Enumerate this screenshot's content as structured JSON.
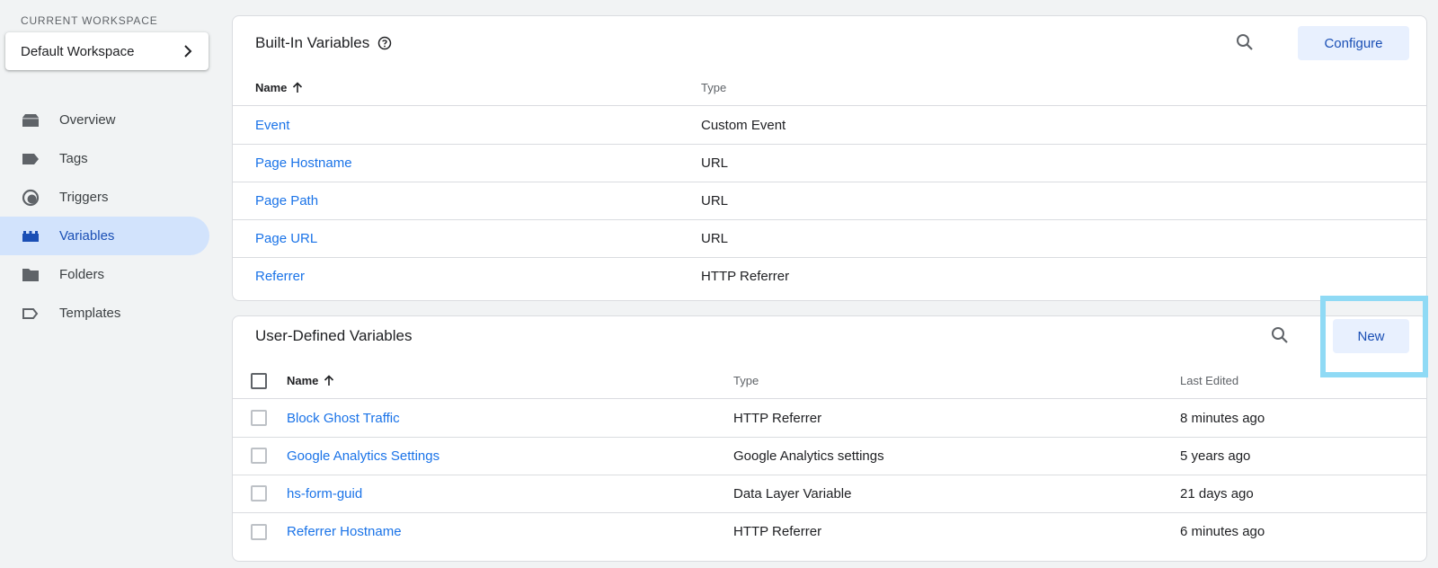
{
  "sidebar": {
    "workspace_label": "CURRENT WORKSPACE",
    "workspace_name": "Default Workspace",
    "items": [
      {
        "label": "Overview",
        "icon": "overview-icon"
      },
      {
        "label": "Tags",
        "icon": "tag-icon"
      },
      {
        "label": "Triggers",
        "icon": "trigger-icon"
      },
      {
        "label": "Variables",
        "icon": "variables-icon",
        "active": true
      },
      {
        "label": "Folders",
        "icon": "folder-icon"
      },
      {
        "label": "Templates",
        "icon": "template-icon"
      }
    ]
  },
  "builtin": {
    "title": "Built-In Variables",
    "configure_label": "Configure",
    "columns": {
      "name": "Name",
      "type": "Type"
    },
    "rows": [
      {
        "name": "Event",
        "type": "Custom Event"
      },
      {
        "name": "Page Hostname",
        "type": "URL"
      },
      {
        "name": "Page Path",
        "type": "URL"
      },
      {
        "name": "Page URL",
        "type": "URL"
      },
      {
        "name": "Referrer",
        "type": "HTTP Referrer"
      }
    ]
  },
  "user_defined": {
    "title": "User-Defined Variables",
    "new_label": "New",
    "columns": {
      "name": "Name",
      "type": "Type",
      "last_edited": "Last Edited"
    },
    "rows": [
      {
        "name": "Block Ghost Traffic",
        "type": "HTTP Referrer",
        "last_edited": "8 minutes ago"
      },
      {
        "name": "Google Analytics Settings",
        "type": "Google Analytics settings",
        "last_edited": "5 years ago"
      },
      {
        "name": "hs-form-guid",
        "type": "Data Layer Variable",
        "last_edited": "21 days ago"
      },
      {
        "name": "Referrer Hostname",
        "type": "HTTP Referrer",
        "last_edited": "6 minutes ago"
      }
    ]
  },
  "colors": {
    "accent": "#1a73e8",
    "active_nav": "#d2e3fc",
    "highlight": "#8fdaf5"
  }
}
